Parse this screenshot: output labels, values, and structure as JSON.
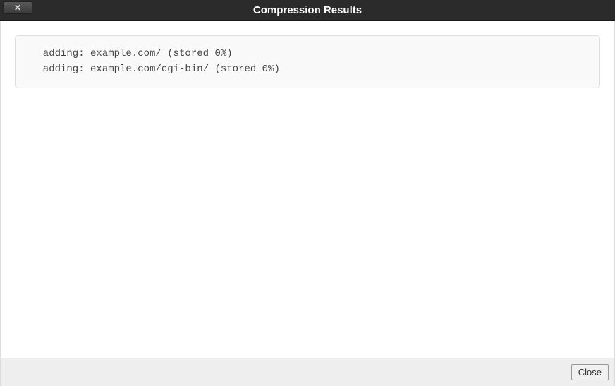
{
  "header": {
    "title": "Compression Results"
  },
  "output": {
    "lines": [
      "  adding: example.com/ (stored 0%)",
      "  adding: example.com/cgi-bin/ (stored 0%)"
    ]
  },
  "footer": {
    "close_label": "Close"
  }
}
